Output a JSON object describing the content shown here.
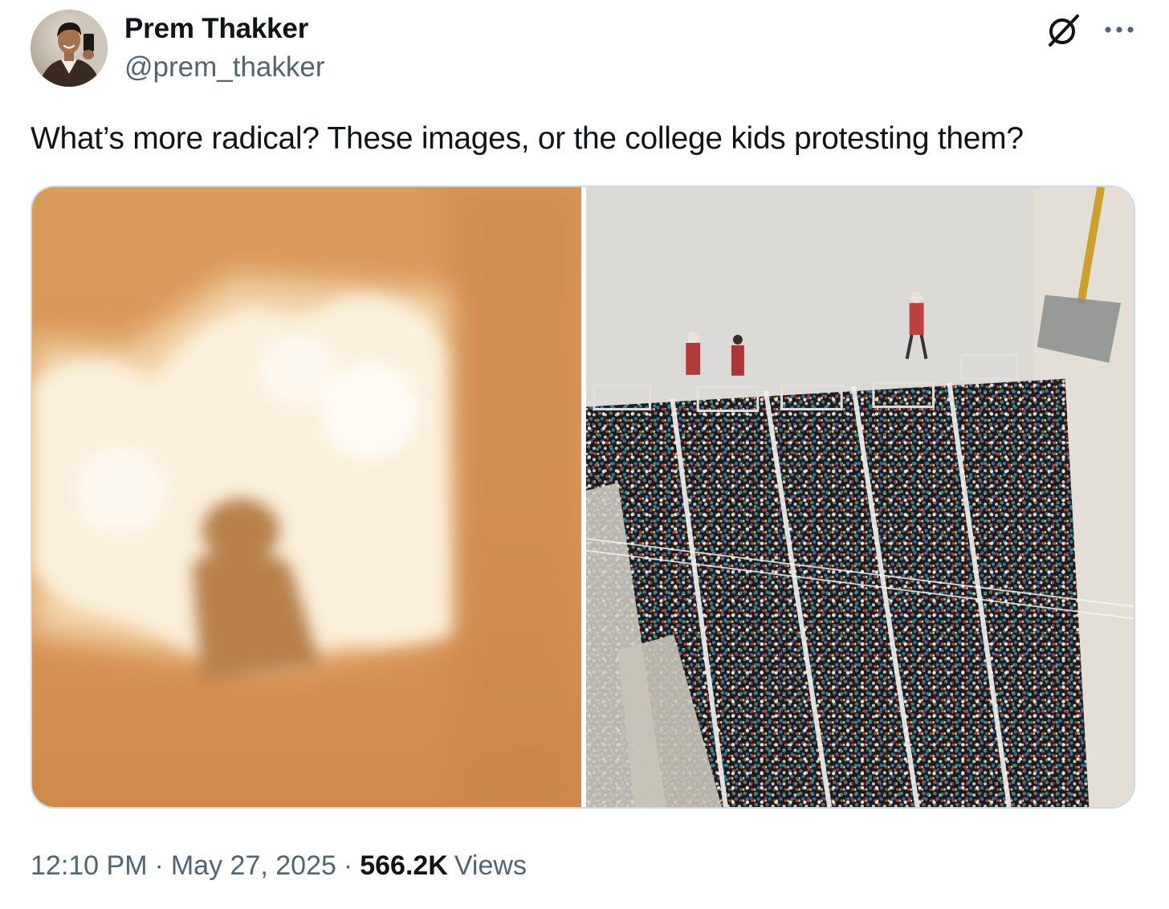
{
  "author": {
    "display_name": "Prem Thakker",
    "handle": "@prem_thakker"
  },
  "icons": {
    "avatar": "user-avatar",
    "grok": "grok-icon",
    "more": "more-horizontal-icon"
  },
  "tweet": {
    "text": "What’s more radical? These images, or the college kids protesting them?"
  },
  "media": {
    "count": 2
  },
  "meta": {
    "time": "12:10 PM",
    "separator": "·",
    "date": "May 27, 2025",
    "views_count": "566.2K",
    "views_label": "Views"
  },
  "colors": {
    "text_primary": "#0f1419",
    "text_secondary": "#536471",
    "border": "#cfd9de"
  }
}
